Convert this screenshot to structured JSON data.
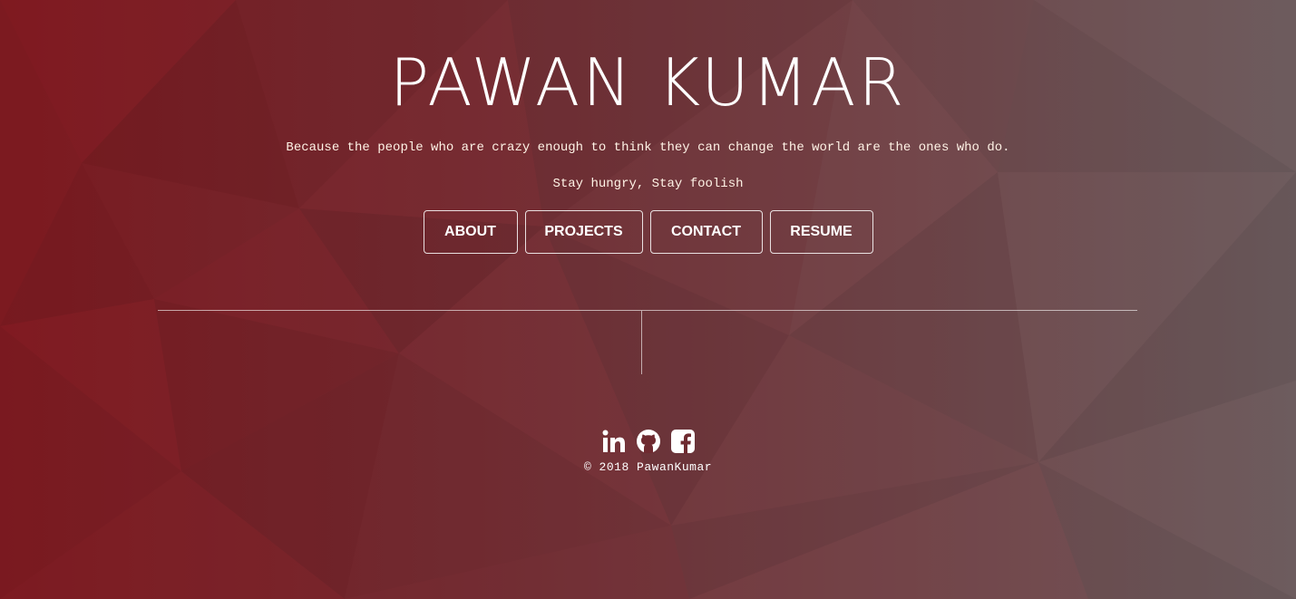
{
  "header": {
    "title": "PAWAN KUMAR",
    "quote": "Because the people who are crazy enough to think they can change the world are the ones who do.",
    "motto": "Stay hungry, Stay foolish"
  },
  "nav": {
    "about": "ABOUT",
    "projects": "PROJECTS",
    "contact": "CONTACT",
    "resume": "RESUME"
  },
  "social": {
    "icons": [
      "linkedin-icon",
      "github-icon",
      "facebook-icon"
    ]
  },
  "footer": {
    "copyright": "© 2018 PawanKumar"
  },
  "colors": {
    "background_left": "#7a1a20",
    "background_right": "#6b5558",
    "text": "#ffffff",
    "quote_text": "#fff3e6"
  }
}
